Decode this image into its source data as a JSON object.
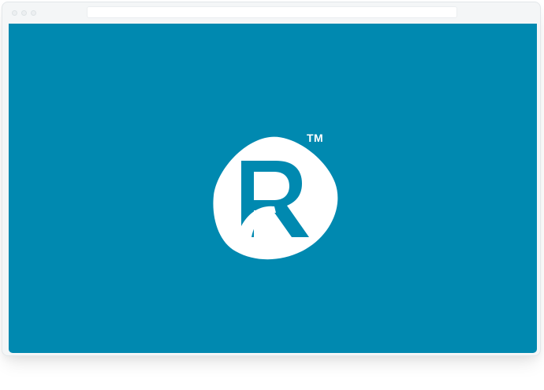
{
  "window": {
    "controls": [
      "close-dot",
      "minimize-dot",
      "maximize-dot"
    ],
    "address_bar": ""
  },
  "content": {
    "background_color": "#0089b0",
    "logo": {
      "icon": "r-logo-icon",
      "letter": "R",
      "trademark": "TM",
      "colors": {
        "badge": "#ffffff",
        "letter": "#0089b0"
      }
    }
  }
}
